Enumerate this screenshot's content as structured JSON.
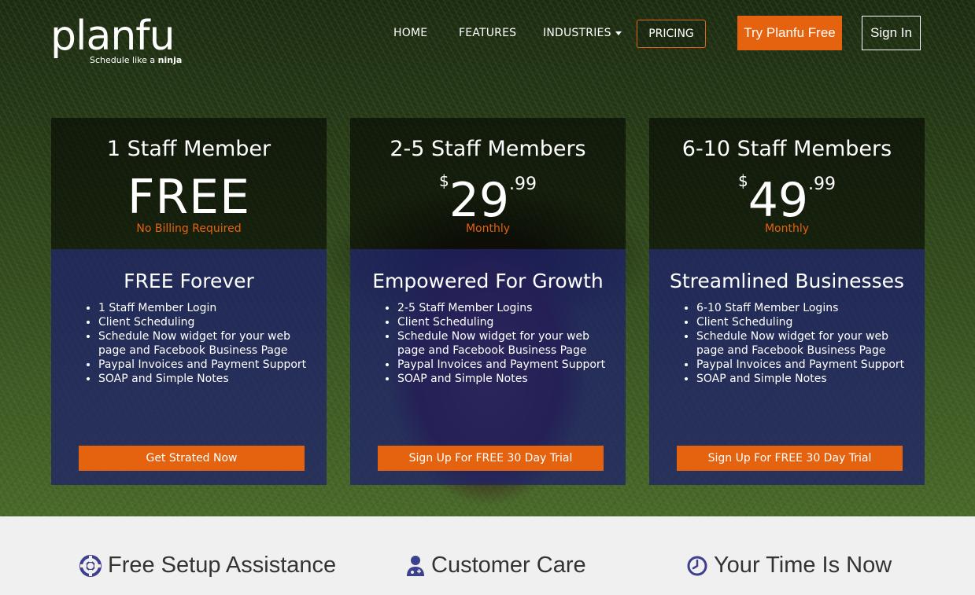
{
  "brand": {
    "name": "planfu",
    "tagline_prefix": "Schedule like a ",
    "tagline_bold": "ninja",
    "accent_color": "#e5620f",
    "card_blue": "#1c1e6e"
  },
  "nav": {
    "home": "HOME",
    "features": "FEATURES",
    "industries": "INDUSTRIES",
    "pricing": "PRICING",
    "try_free": "Try Planfu Free",
    "sign_in": "Sign In"
  },
  "plans": [
    {
      "title": "1 Staff Member",
      "price_text": "FREE",
      "sub": "No Billing Required",
      "plan_name": "FREE Forever",
      "features": [
        "1 Staff Member Login",
        "Client Scheduling",
        "Schedule Now widget for your web page and Facebook Business Page",
        "Paypal Invoices and Payment Support",
        "SOAP and Simple Notes"
      ],
      "cta": "Get Strated Now"
    },
    {
      "title": "2-5 Staff Members",
      "currency": "$",
      "price_main": "29",
      "price_cents": ".99",
      "sub": "Monthly",
      "plan_name": "Empowered For Growth",
      "features": [
        "2-5 Staff Member Logins",
        "Client Scheduling",
        "Schedule Now widget for your web page and Facebook Business Page",
        "Paypal Invoices and Payment Support",
        "SOAP and Simple Notes"
      ],
      "cta": "Sign Up For FREE 30 Day Trial"
    },
    {
      "title": "6-10 Staff Members",
      "currency": "$",
      "price_main": "49",
      "price_cents": ".99",
      "sub": "Monthly",
      "plan_name": "Streamlined Businesses",
      "features": [
        "6-10 Staff Member Logins",
        "Client Scheduling",
        "Schedule Now widget for your web page and Facebook Business Page",
        "Paypal Invoices and Payment Support",
        "SOAP and Simple Notes"
      ],
      "cta": "Sign Up For FREE 30 Day Trial"
    }
  ],
  "bottom_features": [
    {
      "icon": "life-ring-icon",
      "label": "Free Setup Assistance"
    },
    {
      "icon": "user-doctor-icon",
      "label": "Customer Care"
    },
    {
      "icon": "clock-icon",
      "label": "Your Time Is Now"
    }
  ]
}
